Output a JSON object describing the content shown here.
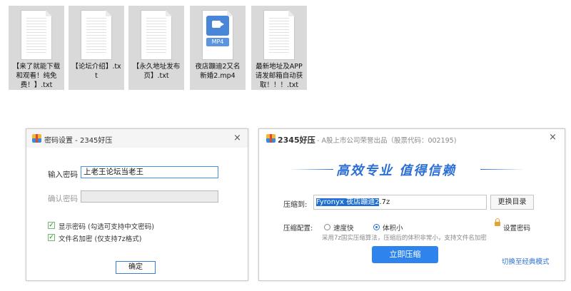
{
  "files": [
    {
      "name": "【来了就能下载和观看！纯免费！】.txt",
      "type": "txt"
    },
    {
      "name": "【论坛介绍】.txt",
      "type": "txt"
    },
    {
      "name": "【永久地址发布页】.txt",
      "type": "txt"
    },
    {
      "name": "夜店蹦迪2又名新婚2.mp4",
      "type": "mp4",
      "tag": "MP4"
    },
    {
      "name": "最新地址及APP请发邮箱自动获取！！！.txt",
      "type": "txt"
    }
  ],
  "password_dialog": {
    "title": "密码设置 - 2345好压",
    "close_icon": "×",
    "enter_label": "输入密码",
    "enter_value": "上老王论坛当老王",
    "confirm_label": "确认密码",
    "confirm_value": "",
    "show_password_label": "显示密码 (勾选可支持中文密码)",
    "show_password_checked": true,
    "encrypt_names_label": "文件名加密 (仅支持7z格式)",
    "encrypt_names_checked": true,
    "ok_label": "确定"
  },
  "compress_dialog": {
    "brand": "2345好压",
    "subtitle": "- A股上市公司荣誉出品（股票代码：002195)",
    "close_icon": "×",
    "slogan": "高效专业 值得信赖",
    "path_label": "压缩到:",
    "path_selected": "Fyronyx   夜店蹦迪2",
    "path_rest": ".7z",
    "browse_label": "更换目录",
    "config_label": "压缩配置:",
    "option_fast": "速度快",
    "option_small": "体积小",
    "selected_option": "体积小",
    "set_password": "设置密码",
    "hint": "采用7z国实压缩算法，压缩后的体积非常小，支持文件名加密",
    "compress_button": "立即压缩",
    "classic_link": "切换至经典模式"
  },
  "colors": {
    "accent": "#2e84ec",
    "slogan": "#2b6fd6",
    "selection": "#1f6fd1"
  }
}
